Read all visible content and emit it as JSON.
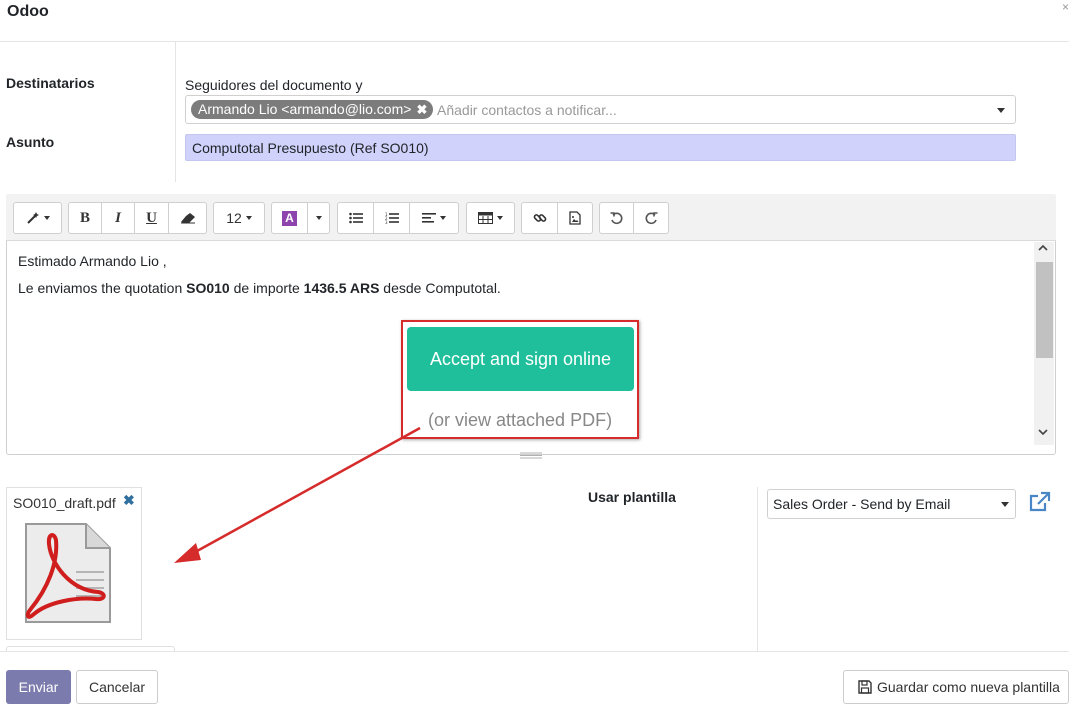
{
  "dialog": {
    "title": "Odoo",
    "close_glyph": "×"
  },
  "recipients": {
    "label": "Destinatarios",
    "hint": "Seguidores del documento y",
    "tag": "Armando Lio <armando@lio.com>",
    "tag_remove_icon": "close-icon",
    "placeholder": "Añadir contactos a notificar..."
  },
  "subject": {
    "label": "Asunto",
    "value": "Computotal Presupuesto (Ref SO010)"
  },
  "toolbar": {
    "font_size": "12",
    "bold": "B",
    "italic": "I",
    "underline": "U",
    "font_color": "A"
  },
  "body": {
    "greeting": "Estimado Armando Lio ,",
    "line_prefix": "Le enviamos the quotation ",
    "order_ref": "SO010",
    "line_middle": " de importe ",
    "amount": "1436.5 ARS",
    "line_suffix": " desde Computotal.",
    "accept_button": "Accept and sign online",
    "view_pdf_text": "(or view attached PDF)"
  },
  "attachment": {
    "filename": "SO010_draft.pdf",
    "remove_glyph": "✖"
  },
  "template": {
    "label": "Usar plantilla",
    "selected": "Sales Order - Send by Email"
  },
  "footer": {
    "send": "Enviar",
    "cancel": "Cancelar",
    "save_template": "Guardar como nueva plantilla"
  },
  "colors": {
    "accept_button": "#1fbf9b",
    "send_button": "#7c7bad",
    "subject_bg": "#d1d2fb",
    "annotation_red": "#d62b2b"
  }
}
